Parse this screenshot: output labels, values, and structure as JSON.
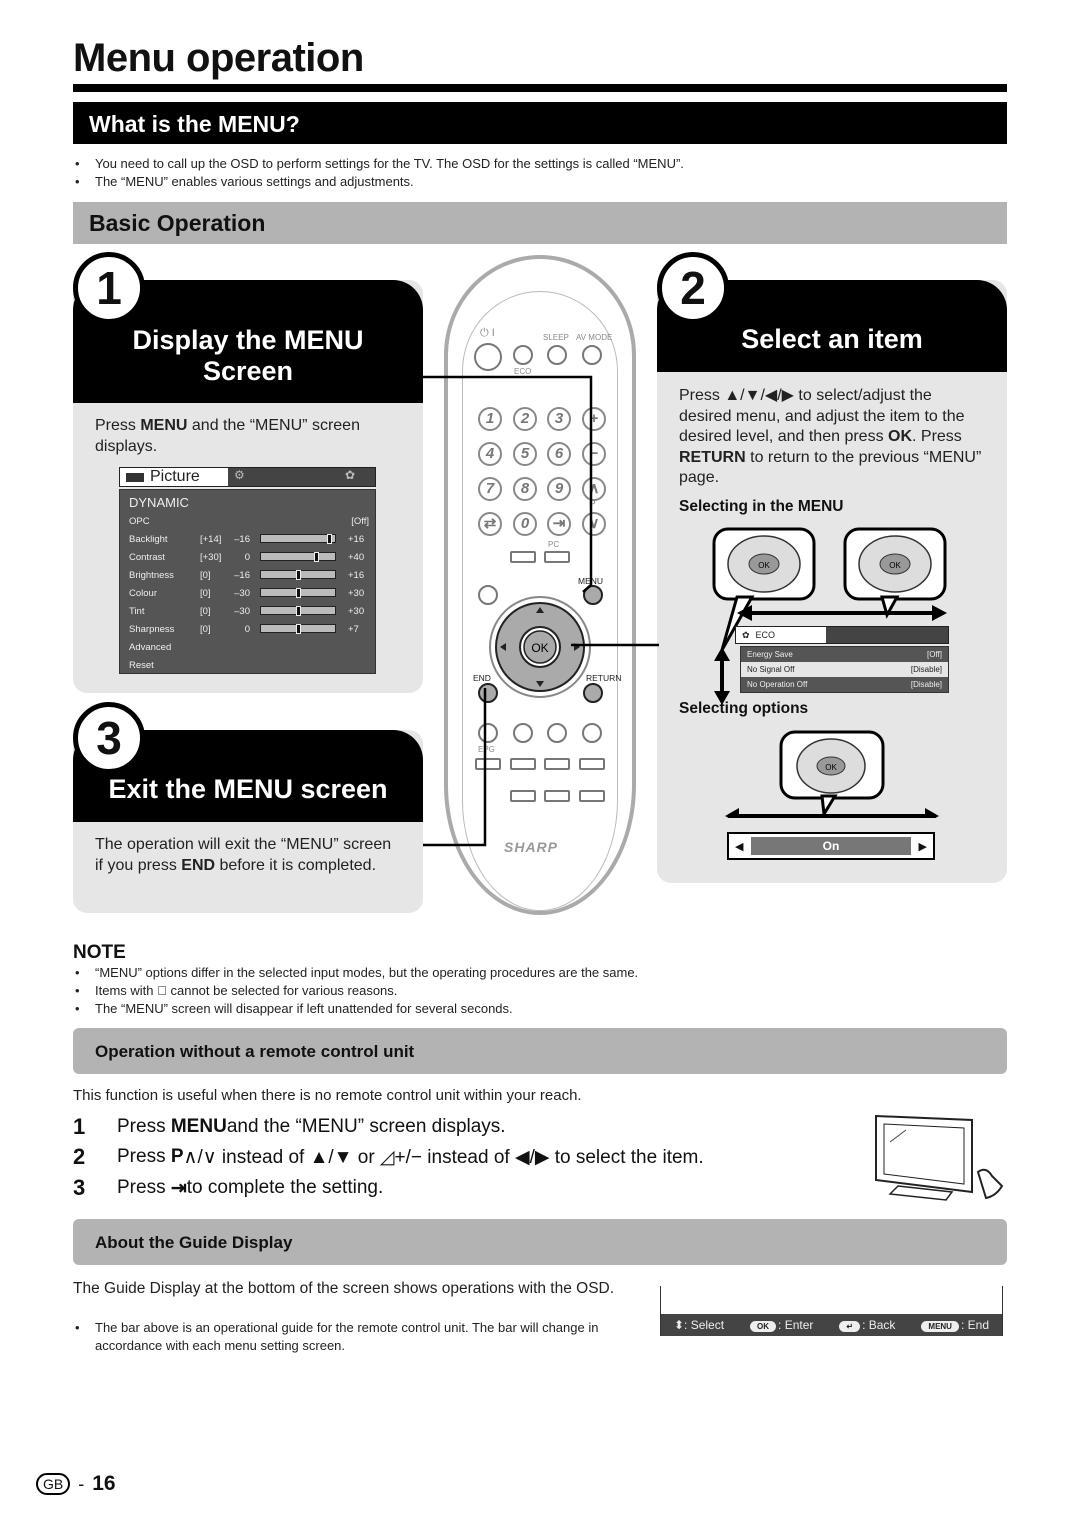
{
  "page_title": "Menu operation",
  "what_is_menu": {
    "heading": "What is the MENU?",
    "bullets": [
      "You need to call up the OSD to perform settings for the TV. The OSD for the settings is called “MENU”.",
      "The “MENU” enables various settings and adjustments."
    ]
  },
  "basic_operation": {
    "heading": "Basic Operation",
    "step1": {
      "number": "1",
      "title_line1": "Display the MENU",
      "title_line2": "Screen",
      "text_pre": "Press ",
      "text_bold": "MENU",
      "text_post": " and the “MENU” screen displays."
    },
    "step2": {
      "number": "2",
      "title": "Select an item",
      "text_a": "Press ▲/▼/◀/▶ to select/adjust the desired menu, and adjust the item to the desired level, and then press ",
      "text_ok": "OK",
      "text_b": ". Press ",
      "text_return": "RETURN",
      "text_c": " to return to the previous “MENU” page.",
      "selecting_menu_label": "Selecting in the MENU",
      "selecting_options_label": "Selecting options",
      "ok_label": "OK",
      "eco_tab": "ECO",
      "eco_rows": [
        {
          "label": "Energy Save",
          "value": "[Off]"
        },
        {
          "label": "No Signal Off",
          "value": "[Disable]"
        },
        {
          "label": "No Operation Off",
          "value": "[Disable]"
        }
      ],
      "option_value": "On"
    },
    "step3": {
      "number": "3",
      "title": "Exit the MENU screen",
      "text_pre": "The operation will exit the “MENU” screen if you press ",
      "text_bold": "END",
      "text_post": " before it is completed."
    }
  },
  "osd": {
    "tab": "Picture",
    "mode": "DYNAMIC",
    "opc_label": "OPC",
    "opc_value": "[Off]",
    "rows": [
      {
        "label": "Backlight",
        "value": "[+14]",
        "min": "–16",
        "max": "+16",
        "level": 0.94
      },
      {
        "label": "Contrast",
        "value": "[+30]",
        "min": "0",
        "max": "+40",
        "level": 0.75
      },
      {
        "label": "Brightness",
        "value": "[0]",
        "min": "–16",
        "max": "+16",
        "level": 0.5
      },
      {
        "label": "Colour",
        "value": "[0]",
        "min": "–30",
        "max": "+30",
        "level": 0.5
      },
      {
        "label": "Tint",
        "value": "[0]",
        "min": "–30",
        "max": "+30",
        "level": 0.5
      },
      {
        "label": "Sharpness",
        "value": "[0]",
        "min": "0",
        "max": "+7",
        "level": 0.5
      }
    ],
    "advanced": "Advanced",
    "reset": "Reset"
  },
  "remote": {
    "power": "⏻ I",
    "sleep": "SLEEP",
    "av_mode": "AV MODE",
    "eco": "ECO",
    "numbers": [
      "1",
      "2",
      "3",
      "4",
      "5",
      "6",
      "7",
      "8",
      "9",
      "0"
    ],
    "pc": "PC",
    "menu": "MENU",
    "ok": "OK",
    "end": "END",
    "return": "RETURN",
    "epg": "EPG",
    "p": "P",
    "brand": "SHARP"
  },
  "note": {
    "heading": "NOTE",
    "bullets": [
      "“MENU” options differ in the selected input modes, but the operating procedures are the same.",
      "Items with ⃠ cannot be selected for various reasons.",
      "The “MENU” screen will disappear if left unattended for several seconds."
    ]
  },
  "no_remote": {
    "heading": "Operation without a remote control unit",
    "intro": "This function is useful when there is no remote control unit within your reach.",
    "steps": [
      {
        "num": "1",
        "pre": "Press ",
        "bold": "MENU",
        "post": " and the “MENU” screen displays."
      },
      {
        "num": "2",
        "pre": "Press ",
        "bold": "P",
        "post": "∧/∨ instead of ▲/▼ or ◿+/− instead of ◀/▶ to select the item."
      },
      {
        "num": "3",
        "pre": "Press ",
        "bold": "⇥",
        "post": " to complete the setting."
      }
    ]
  },
  "guide": {
    "heading": "About the Guide Display",
    "text": "The Guide Display at the bottom of the screen shows operations with the OSD.",
    "bullet": "The bar above is an operational guide for the remote control unit. The bar will change in accordance with each menu setting screen.",
    "bar": [
      {
        "key": "⬍",
        "label": ": Select"
      },
      {
        "key": "OK",
        "label": ": Enter"
      },
      {
        "key": "↵",
        "label": ": Back"
      },
      {
        "key": "MENU",
        "label": ": End"
      }
    ]
  },
  "footer": {
    "region": "GB",
    "page": "16"
  }
}
